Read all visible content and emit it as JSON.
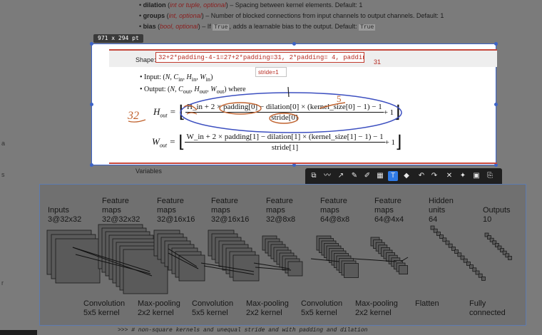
{
  "doc": {
    "bullets": [
      {
        "name": "dilation",
        "type": "int or tuple, optional",
        "desc": " – Spacing between kernel elements. Default: 1"
      },
      {
        "name": "groups",
        "type": "int, optional",
        "desc": " – Number of blocked connections from input channels to output channels. Default: 1"
      },
      {
        "name": "bias",
        "type": "bool, optional",
        "desc_pre": " – If ",
        "code": "True",
        "desc_post": ", adds a learnable bias to the output. Default: ",
        "default": "True"
      }
    ],
    "variables_label": "Variables",
    "bottom_code": ">>> # non-square kernels and unequal stride and with padding and dilation"
  },
  "capture": {
    "size_badge": "971 x 294  pt",
    "shape_label": "Shape:",
    "shape_annotation": "32+2*padding-4-1=27+2*padding=31, 2*padding= 4, padding=2",
    "side_note": "31",
    "stride_note": "stride=1",
    "input_line": "Input: (N, C_in, H_in, W_in)",
    "output_line": "Output: (N, C_out, H_out, W_out) where",
    "handwritten": {
      "h_mark": "32",
      "five": "5",
      "one": "1"
    },
    "formula_h": {
      "lhs": "H_out =",
      "num": "H_in + 2 × padding[0] − dilation[0] × (kernel_size[0] − 1) − 1",
      "den": "stride[0]",
      "tail": "+ 1"
    },
    "formula_w": {
      "lhs": "W_out =",
      "num": "W_in + 2 × padding[1] − dilation[1] × (kernel_size[1] − 1) − 1",
      "den": "stride[1]",
      "tail": "+ 1"
    }
  },
  "toolbar": {
    "font": "Lucida Grande",
    "size": "4",
    "accent": "#2f7be6",
    "color_selected": "#c00000",
    "palette": [
      "#000000",
      "#ffffff",
      "#ff0000",
      "#ff8800",
      "#ffee00",
      "#00cc00",
      "#00aaff",
      "#0044ff",
      "#8800cc",
      "#ff44aa",
      "#888888",
      "#444444",
      "#ff9999",
      "#ffcc99",
      "#ffffaa",
      "#aaffaa",
      "#aaddff",
      "#bbbbff",
      "#dd99ff",
      "#cccccc"
    ]
  },
  "cnn": {
    "top_labels": [
      {
        "text": "Inputs\n3@32x32"
      },
      {
        "text": "Feature\nmaps\n32@32x32"
      },
      {
        "text": "Feature\nmaps\n32@16x16"
      },
      {
        "text": "Feature\nmaps\n32@16x16"
      },
      {
        "text": "Feature\nmaps\n32@8x8"
      },
      {
        "text": "Feature\nmaps\n64@8x8"
      },
      {
        "text": "Feature\nmaps\n64@4x4"
      },
      {
        "text": "Hidden\nunits\n64"
      },
      {
        "text": "Outputs\n10"
      }
    ],
    "bottom_labels": [
      {
        "text": "Convolution\n5x5 kernel"
      },
      {
        "text": "Max-pooling\n2x2 kernel"
      },
      {
        "text": "Convolution\n5x5 kernel"
      },
      {
        "text": "Max-pooling\n2x2 kernel"
      },
      {
        "text": "Convolution\n5x5 kernel"
      },
      {
        "text": "Max-pooling\n2x2 kernel"
      },
      {
        "text": "Flatten"
      },
      {
        "text": "Fully\nconnected"
      }
    ]
  }
}
